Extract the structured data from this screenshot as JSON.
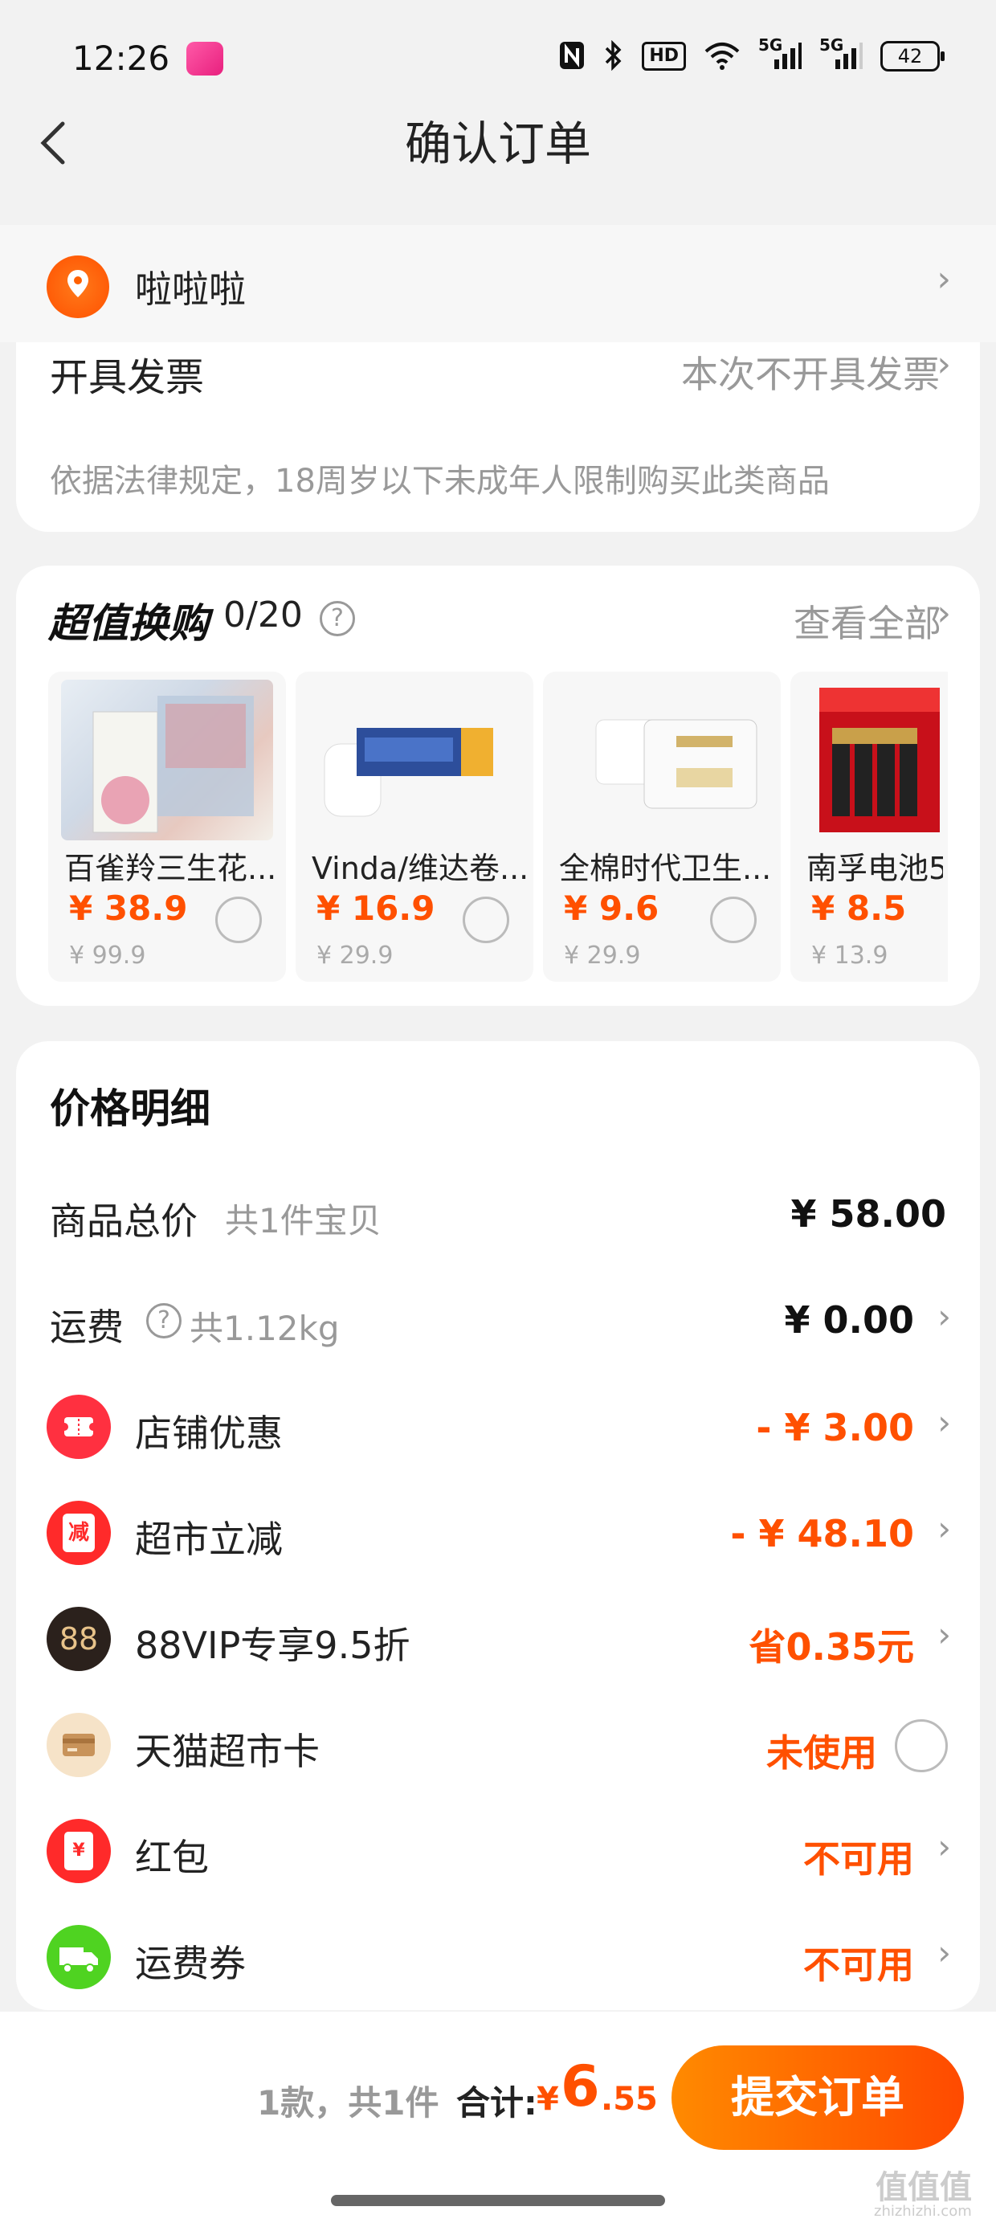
{
  "status_bar": {
    "time": "12:26",
    "icons": [
      "nfc-icon",
      "bluetooth-icon",
      "hd-icon",
      "wifi-icon",
      "5g-signal-icon",
      "5g-signal-icon"
    ],
    "hd_text": "HD",
    "sig1": "5G",
    "sig2": "5G",
    "battery": "42"
  },
  "nav": {
    "title": "确认订单",
    "back_icon": "chevron-left-icon"
  },
  "address": {
    "name": "啦啦啦",
    "icon": "location-pin-icon"
  },
  "invoice": {
    "label": "开具发票",
    "value": "本次不开具发票"
  },
  "notice": "依据法律规定，18周岁以下未成年人限制购买此类商品",
  "swap": {
    "title": "超值换购",
    "count": "0/20",
    "help": "?",
    "view_all": "查看全部",
    "products": [
      {
        "name": "百雀羚三生花...",
        "price": "¥ 38.9",
        "orig": "¥ 99.9"
      },
      {
        "name": "Vinda/维达卷...",
        "price": "¥ 16.9",
        "orig": "¥ 29.9"
      },
      {
        "name": "全棉时代卫生...",
        "price": "¥ 9.6",
        "orig": "¥ 29.9"
      },
      {
        "name": "南孚电池5",
        "price": "¥ 8.5",
        "orig": "¥ 13.9"
      }
    ]
  },
  "price_detail": {
    "title": "价格明细",
    "total_label": "商品总价",
    "total_sub": "共1件宝贝",
    "total_value": "¥ 58.00",
    "shipping_label": "运费",
    "shipping_sub": "共1.12kg",
    "shipping_value": "¥ 0.00",
    "rows": [
      {
        "label": "店铺优惠",
        "value": "- ¥ 3.00",
        "icon": "shop-coupon-icon"
      },
      {
        "label": "超市立减",
        "value": "- ¥ 48.10",
        "icon": "discount-icon",
        "icon_text": "减"
      },
      {
        "label": "88VIP专享9.5折",
        "value": "省0.35元",
        "icon": "vip88-icon",
        "icon_text": "88"
      },
      {
        "label": "天猫超市卡",
        "value": "未使用",
        "icon": "card-icon"
      },
      {
        "label": "红包",
        "value": "不可用",
        "icon": "red-packet-icon",
        "icon_text": "¥"
      },
      {
        "label": "运费券",
        "value": "不可用",
        "icon": "truck-icon"
      }
    ]
  },
  "bottom": {
    "count_text": "1款，共1件",
    "total_label": "合计:",
    "currency": "¥",
    "amount_int": "6",
    "amount_dec": ".55",
    "submit": "提交订单"
  },
  "watermark": {
    "text": "值值值",
    "url": "zhizhizhi.com"
  },
  "colors": {
    "accent": "#ff5000",
    "background": "#f2f2f2",
    "card": "#ffffff"
  }
}
